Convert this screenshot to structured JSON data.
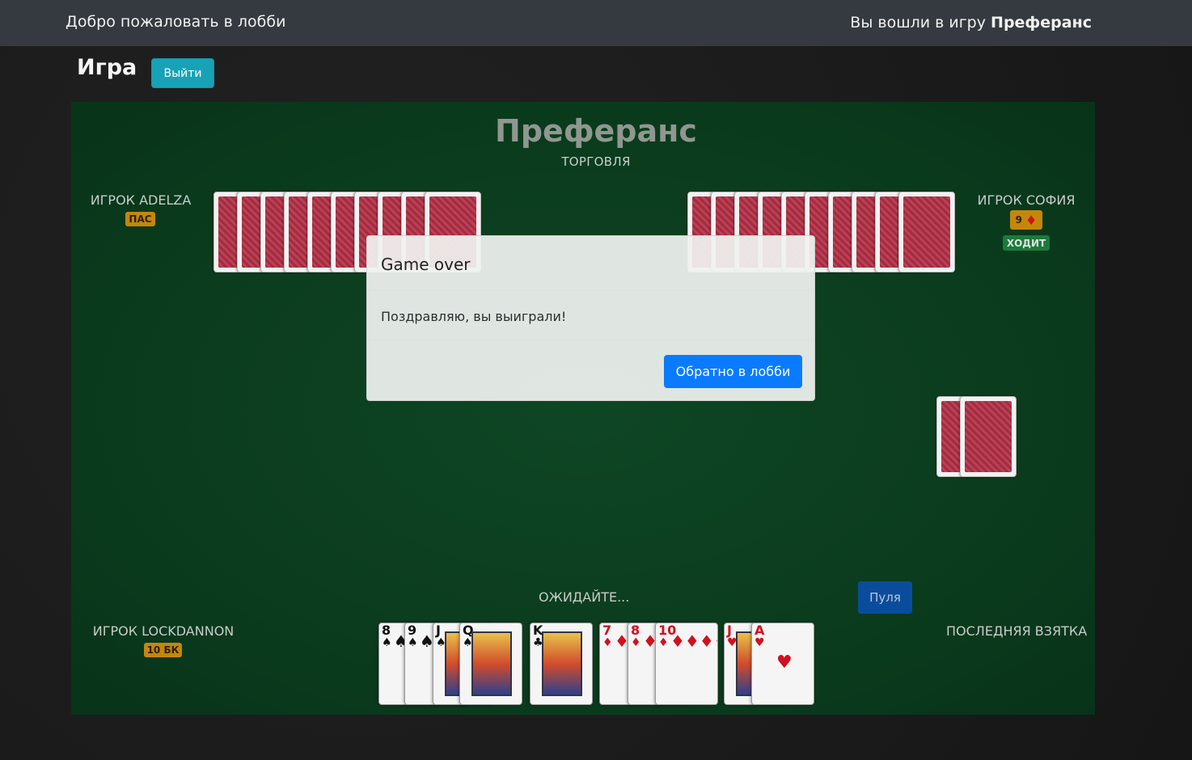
{
  "navbar": {
    "welcome": "Добро пожаловать в лобби",
    "joined_prefix": "Вы вошли в игру",
    "joined_game": "Преферанс"
  },
  "header": {
    "title": "Игра",
    "exit_label": "Выйти"
  },
  "table": {
    "game_title": "Преферанс",
    "phase": "ТОРГОВЛЯ",
    "colors": {
      "felt": "#0b3d1f",
      "accent": "#0a7bff",
      "badge": "#c4870a"
    }
  },
  "players": {
    "left": {
      "name": "ИГРОК ADELZA",
      "badge": "ПАС"
    },
    "right": {
      "name": "ИГРОК СОФИЯ",
      "bid_number": "9",
      "bid_suit": "♦",
      "status": "ХОДИТ"
    },
    "bottom": {
      "name": "ИГРОК LOCKDANNON",
      "badge": "10 БК"
    }
  },
  "hand": [
    {
      "rank": "8",
      "suit": "♠",
      "color": "black"
    },
    {
      "rank": "9",
      "suit": "♠",
      "color": "black"
    },
    {
      "rank": "J",
      "suit": "♠",
      "color": "black"
    },
    {
      "rank": "Q",
      "suit": "♠",
      "color": "black"
    },
    {
      "rank": "K",
      "suit": "♣",
      "color": "black"
    },
    {
      "rank": "7",
      "suit": "♦",
      "color": "red"
    },
    {
      "rank": "8",
      "suit": "♦",
      "color": "red"
    },
    {
      "rank": "10",
      "suit": "♦",
      "color": "red"
    },
    {
      "rank": "J",
      "suit": "♥",
      "color": "red"
    },
    {
      "rank": "A",
      "suit": "♥",
      "color": "red"
    }
  ],
  "status": {
    "waiting": "ОЖИДАЙТЕ...",
    "pula_label": "Пуля",
    "last_trick": "ПОСЛЕДНЯЯ ВЗЯТКА"
  },
  "modal": {
    "title": "Game over",
    "message": "Поздравляю, вы выиграли!",
    "button": "Обратно в лобби"
  }
}
